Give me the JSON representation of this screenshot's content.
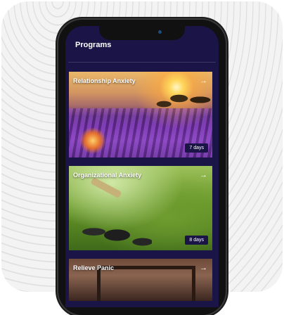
{
  "header": {
    "title": "Programs"
  },
  "programs": [
    {
      "title": "Relationship Anxiety",
      "duration": "7 days",
      "arrow": "→"
    },
    {
      "title": "Organizational Anxiety",
      "duration": "8 days",
      "arrow": "→"
    },
    {
      "title": "Relieve Panic",
      "arrow": "→"
    }
  ],
  "colors": {
    "screen_bg": "#1b1447",
    "badge_bg": "#1b1447"
  }
}
